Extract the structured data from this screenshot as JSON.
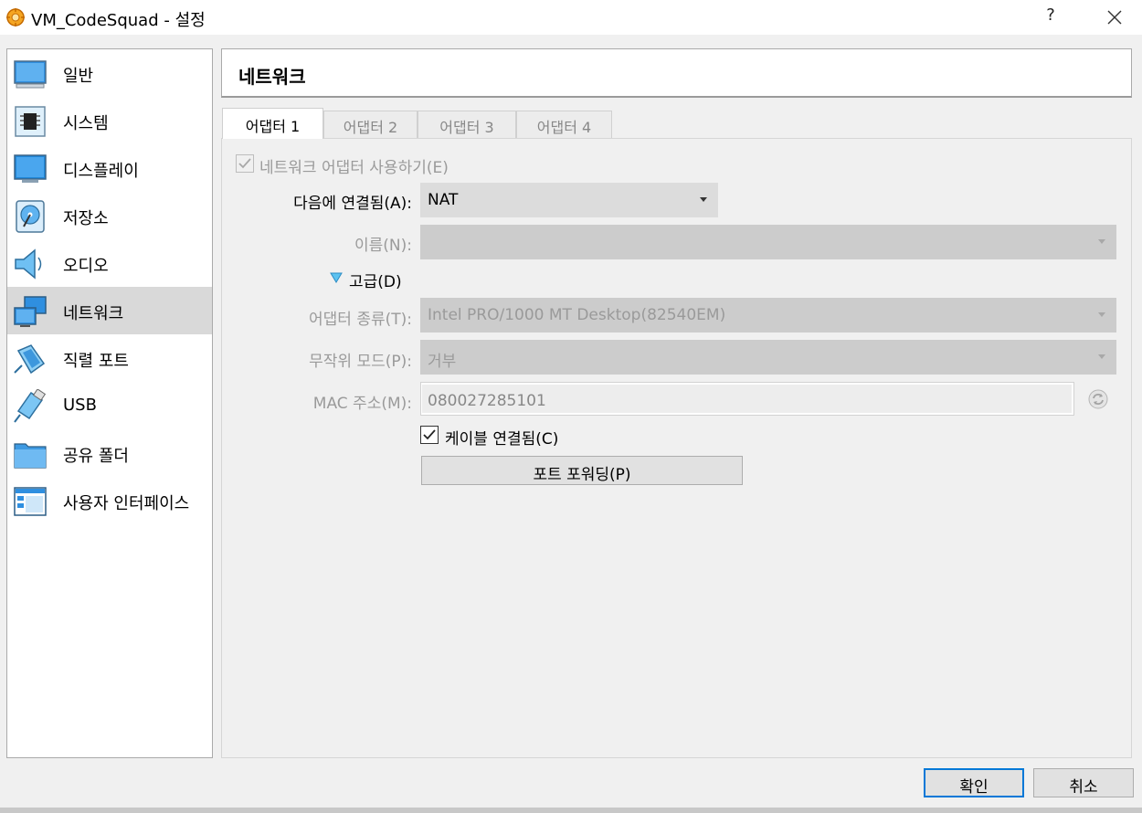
{
  "window": {
    "title": "VM_CodeSquad - 설정",
    "help_label": "?"
  },
  "sidebar": {
    "items": [
      {
        "label": "일반",
        "icon": "general-icon"
      },
      {
        "label": "시스템",
        "icon": "system-icon"
      },
      {
        "label": "디스플레이",
        "icon": "display-icon"
      },
      {
        "label": "저장소",
        "icon": "storage-icon"
      },
      {
        "label": "오디오",
        "icon": "audio-icon"
      },
      {
        "label": "네트워크",
        "icon": "network-icon",
        "selected": true
      },
      {
        "label": "직렬 포트",
        "icon": "serial-port-icon"
      },
      {
        "label": "USB",
        "icon": "usb-icon"
      },
      {
        "label": "공유 폴더",
        "icon": "shared-folder-icon"
      },
      {
        "label": "사용자 인터페이스",
        "icon": "user-interface-icon"
      }
    ]
  },
  "section": {
    "title": "네트워크"
  },
  "tabs": [
    {
      "label": "어댑터 1",
      "active": true
    },
    {
      "label": "어댑터 2"
    },
    {
      "label": "어댑터 3"
    },
    {
      "label": "어댑터 4"
    }
  ],
  "adapter": {
    "enable_label": "네트워크 어댑터 사용하기(E)",
    "enable_checked": true,
    "attached_to_label": "다음에 연결됨(A):",
    "attached_to_value": "NAT",
    "name_label": "이름(N):",
    "name_value": "",
    "advanced_label": "고급(D)",
    "adapter_type_label": "어댑터 종류(T):",
    "adapter_type_value": "Intel PRO/1000 MT Desktop(82540EM)",
    "promiscuous_label": "무작위 모드(P):",
    "promiscuous_value": "거부",
    "mac_label": "MAC 주소(M):",
    "mac_value": "080027285101",
    "cable_connected_label": "케이블 연결됨(C)",
    "cable_connected_checked": true,
    "port_forwarding_label": "포트 포워딩(P)"
  },
  "footer": {
    "ok_label": "확인",
    "cancel_label": "취소"
  },
  "colors": {
    "accent": "#0078d7",
    "selected_bg": "#d9d9d9",
    "disabled_text": "#9a9a9a"
  }
}
